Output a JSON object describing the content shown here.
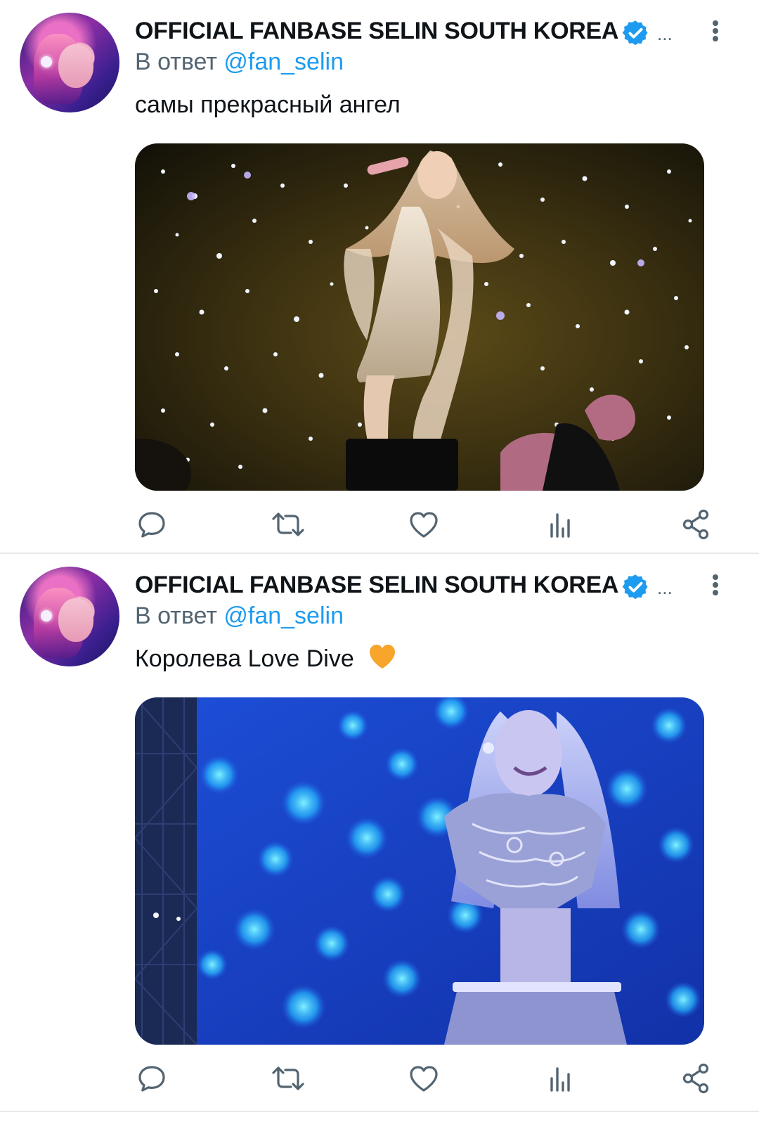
{
  "tweets": [
    {
      "author_name": "OFFICIAL FANBASE SELIN SOUTH KOREA",
      "name_truncation": "...",
      "reply_prefix": "В ответ",
      "reply_mention": "@fan_selin",
      "text": "самы прекрасный ангел",
      "emoji": "",
      "media_alt": "Performer in sparkling dress singing on stage with starry backdrop"
    },
    {
      "author_name": "OFFICIAL FANBASE SELIN SOUTH KOREA",
      "name_truncation": "...",
      "reply_prefix": "В ответ",
      "reply_mention": "@fan_selin",
      "text": "Королева Love Dive",
      "emoji": "orange-heart",
      "media_alt": "Performer singing with headset in front of blue lights"
    }
  ],
  "colors": {
    "verified_badge": "#1d9bf0",
    "mention": "#1d9bf0",
    "secondary_text": "#536471",
    "icon": "#536471",
    "separator": "#e6e8ea"
  },
  "icons": [
    "verified-badge-icon",
    "more-vertical-icon",
    "reply-icon",
    "retweet-icon",
    "like-icon",
    "views-icon",
    "share-icon"
  ]
}
